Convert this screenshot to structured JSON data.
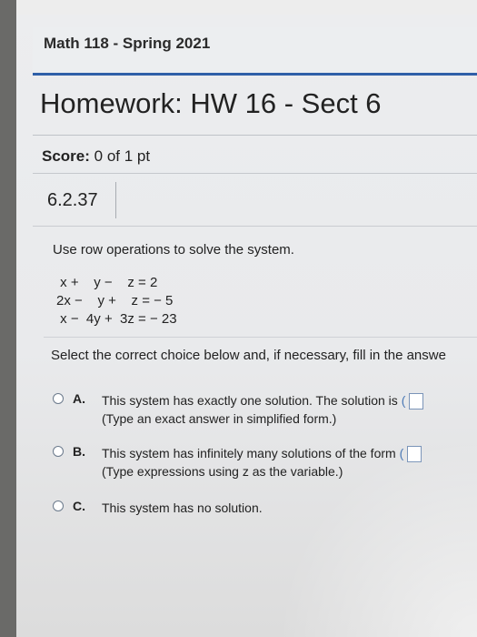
{
  "course": {
    "title": "Math 118 - Spring 2021"
  },
  "homework": {
    "title": "Homework: HW 16 - Sect 6"
  },
  "score": {
    "label": "Score:",
    "value": "0 of 1 pt"
  },
  "question": {
    "number": "6.2.37",
    "instructions": "Use row operations to solve the system.",
    "equations": [
      " x +    y −    z = 2",
      "2x −    y +    z = − 5",
      " x −  4y +  3z = − 23"
    ],
    "select_text": "Select the correct choice below and, if necessary, fill in the answe",
    "options": [
      {
        "letter": "A.",
        "text": "This system has exactly one solution. The solution is",
        "sub": "(Type an exact answer in simplified form.)"
      },
      {
        "letter": "B.",
        "text": "This system has infinitely many solutions of the form",
        "sub": "(Type expressions using z as the variable.)"
      },
      {
        "letter": "C.",
        "text": "This system has no solution."
      }
    ]
  }
}
